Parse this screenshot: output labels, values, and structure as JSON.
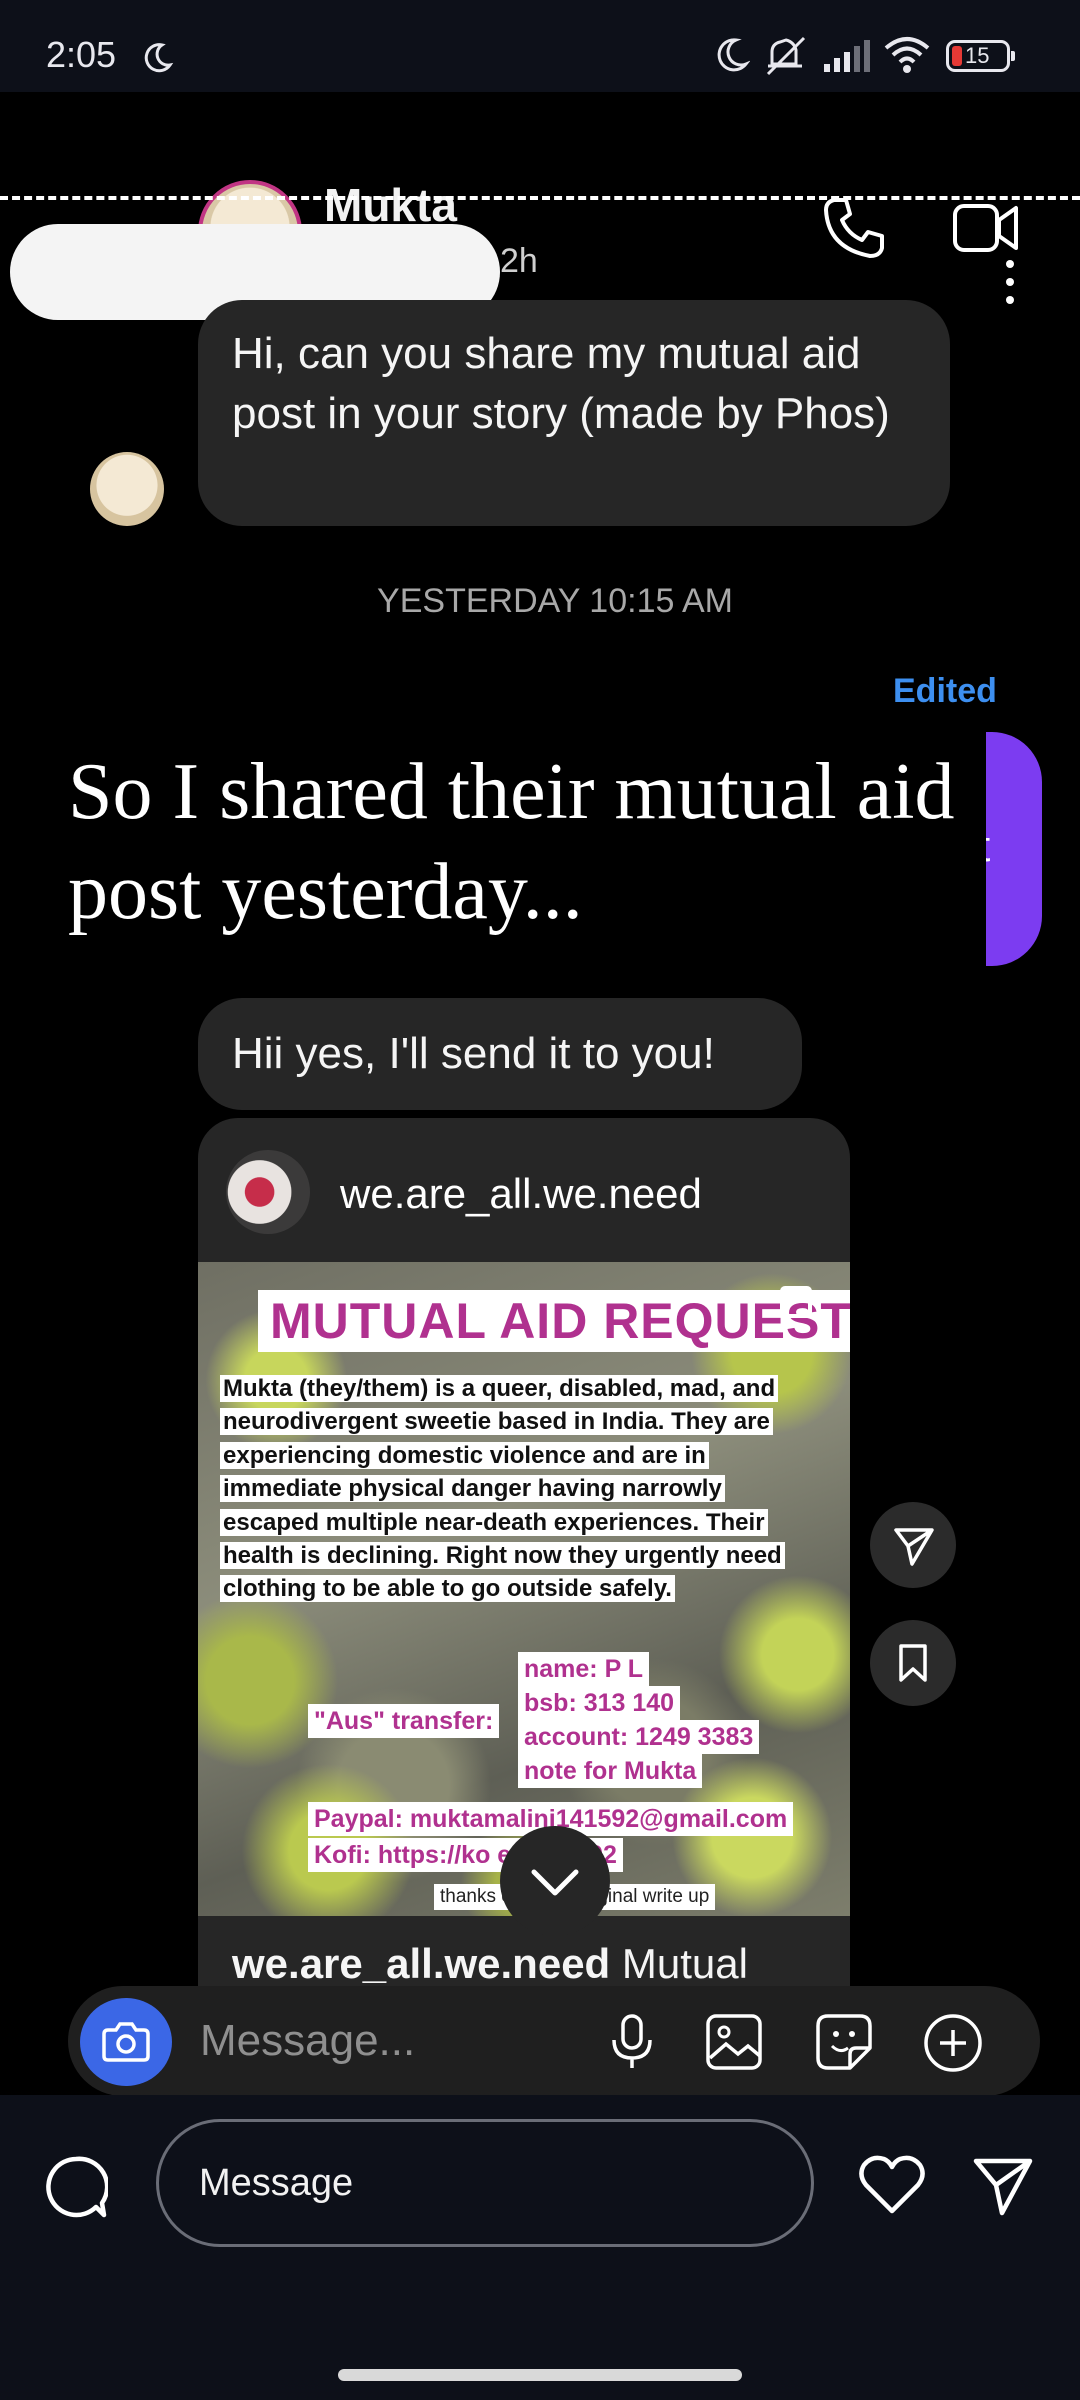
{
  "status_bar": {
    "time": "2:05",
    "battery": "15",
    "icons": [
      "moon-crescent-icon",
      "do-not-disturb-icon",
      "vibrate-off-icon",
      "signal-icon",
      "wifi-icon",
      "battery-icon"
    ]
  },
  "thread": {
    "contact_name": "Mukta",
    "contact_sub": "2h",
    "header_icons": [
      "phone-icon",
      "video-call-icon",
      "more-options-icon"
    ],
    "messages": [
      {
        "id": "m1",
        "text": "Hi, can you share my mutual aid post in your story (made by Phos)"
      },
      {
        "id": "m2",
        "text": "Hii yes, I'll send it to you!"
      }
    ],
    "timestamp": "YESTERDAY 10:15 AM",
    "edited_label": "Edited",
    "purple_bubble_hint": "t",
    "shared_post": {
      "username": "we.are_all.we.need",
      "image_title": "MUTUAL AID REQUEST",
      "image_body": "Mukta (they/them) is a queer, disabled, mad, and neurodivergent sweetie based in India. They are experiencing domestic violence and are in immediate physical danger having narrowly escaped multiple near-death experiences. Their health is declining. Right now they urgently need clothing to be able to go outside safely.",
      "aus_label": "\"Aus\" transfer:",
      "bank_name": "name: P L",
      "bank_bsb": "bsb: 313 140",
      "bank_account": "account: 1249 3383",
      "bank_note": "note for Mukta",
      "paypal": "Paypal: muktamalini141592@gmail.com",
      "kofi": "Kofi: https://ko             em141592",
      "footnote": "thanks                    e for the original write up",
      "caption": "we.are_all.we.need Mutual"
    },
    "composer_placeholder": "Message..."
  },
  "story_caption": "So I shared their mutual aid post yesterday...",
  "reply_bar": {
    "placeholder": "Message"
  },
  "colors": {
    "background": "#000000",
    "bubble": "#262626",
    "own_bubble": "#7c3cf1",
    "edited": "#3d8ff0",
    "camera_button": "#3b67e6",
    "accent_magenta": "#b0318f"
  }
}
